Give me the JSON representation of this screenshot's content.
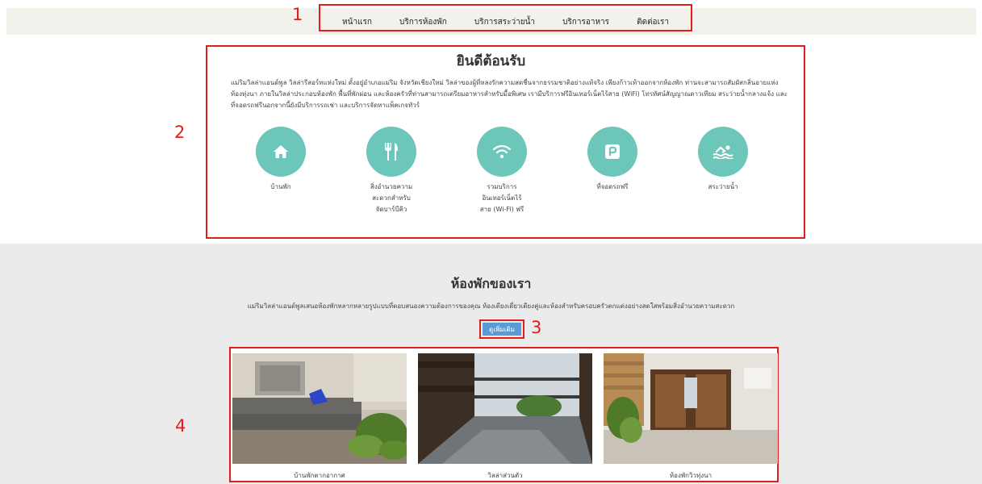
{
  "nav": {
    "items": [
      "หน้าแรก",
      "บริการห้องพัก",
      "บริการสระว่ายน้ำ",
      "บริการอาหาร",
      "ติดต่อเรา"
    ]
  },
  "annotations": [
    "1",
    "2",
    "3",
    "4"
  ],
  "welcome": {
    "title": "ยินดีต้อนรับ",
    "text": "แม่ริมวิลล่าแอนด์พูล วิลล่ารีสอร์ทแห่งใหม่ ตั้งอยู่อำเภอแม่ริม จังหวัดเชียงใหม่ วิลล่าของผู้ที่หลงรักความสดชื่นจากธรรมชาติอย่างแท้จริง เพียงก้าวเท้าออกจากห้องพัก ท่านจะสามารถสัมผัสกลิ่นอายแห่งท้องทุ่งนา ภายในวิลล่าประกอบห้องพัก พื้นที่พักผ่อน และห้องครัวที่ท่านสามารถเตรียมอาหารสำหรับมื้อพิเศษ เรามีบริการฟรีอินเทอร์เน็ตไร้สาย (WiFi) โทรทัศน์สัญญาณดาวเทียม สระว่ายน้ำกลางแจ้ง และที่จอดรถฟรีนอกจากนี้ยังมีบริการรถเช่า และบริการจัดหาแพ็คเกจทัวร์",
    "features": [
      {
        "label": "บ้านพัก",
        "icon": "home-icon"
      },
      {
        "label": "สิ่งอำนวยความ\nสะดวกสำหรับ\nจัดบาร์บีคิว",
        "icon": "utensils-icon"
      },
      {
        "label": "รวมบริการ\nอินเทอร์เน็ตไร้\nสาย (Wi-Fi) ฟรี",
        "icon": "wifi-icon"
      },
      {
        "label": "ที่จอดรถฟรี",
        "icon": "parking-icon"
      },
      {
        "label": "สระว่ายน้ำ",
        "icon": "swimmer-icon"
      }
    ]
  },
  "rooms": {
    "title": "ห้องพักของเรา",
    "text": "แม่ริมวิลล่าแอนด์พูลเสนอห้องพักหลากหลายรูปแบบที่ตอบสนองความต้องการของคุณ ห้องเตียงเดี่ยวเตียงคู่และห้องสำหรับครอบครัวตกแต่งอย่างสดใสพร้อมสิ่งอำนวยความสะดวก",
    "more_button": "ดูเพิ่มเติม",
    "cards": [
      {
        "caption": "บ้านพักตากอากาศ"
      },
      {
        "caption": "วิลล่าส่วนตัว"
      },
      {
        "caption": "ห้องพักวิวทุ่งนา"
      }
    ]
  },
  "colors": {
    "accent": "#6cc6ba",
    "annotation": "#e01e1e",
    "button": "#5b9bd5"
  }
}
